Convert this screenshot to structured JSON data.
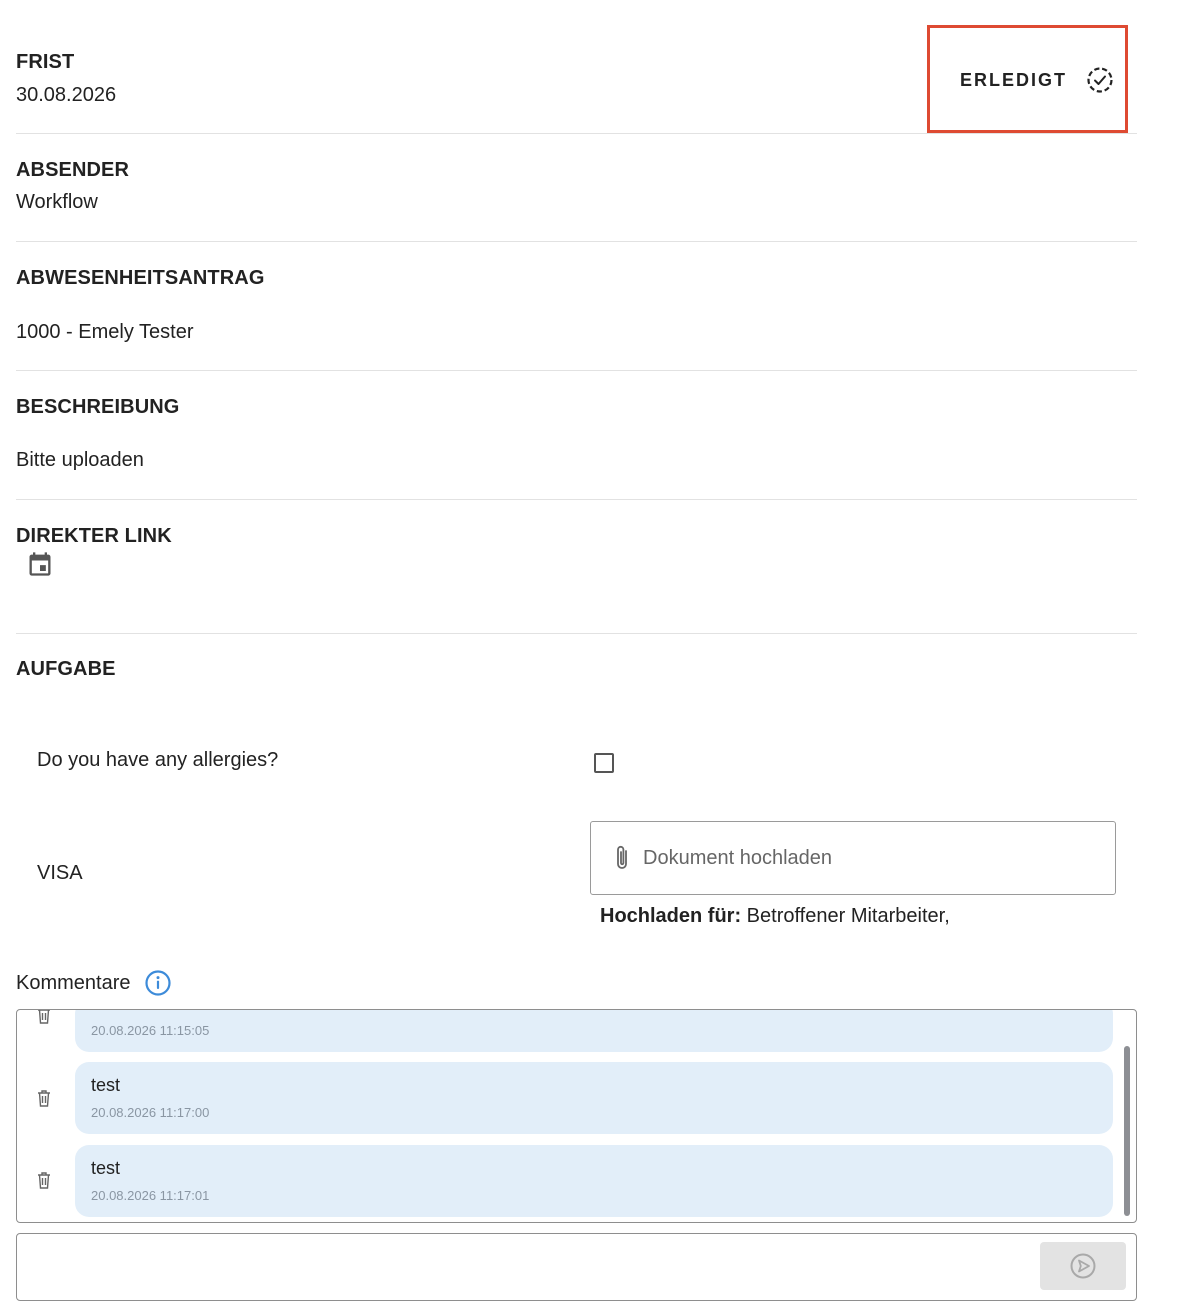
{
  "deadline": {
    "label": "FRIST",
    "value": "30.08.2026"
  },
  "done_button": {
    "label": "ERLEDIGT",
    "icon": "dashed-check-circle-icon",
    "highlight_color": "#de4a32"
  },
  "sender": {
    "label": "ABSENDER",
    "value": "Workflow"
  },
  "absence_request": {
    "label": "ABWESENHEITSANTRAG",
    "value": "1000 - Emely Tester"
  },
  "description": {
    "label": "BESCHREIBUNG",
    "value": "Bitte uploaden"
  },
  "direct_link": {
    "label": "DIREKTER LINK",
    "icon": "calendar-icon"
  },
  "task": {
    "label": "AUFGABE",
    "question": "Do you have any allergies?",
    "checkbox_checked": false,
    "visa_label": "VISA",
    "upload_placeholder": "Dokument hochladen",
    "upload_for_label": "Hochladen für:",
    "upload_for_value": " Betroffener Mitarbeiter,"
  },
  "comments": {
    "title": "Kommentare",
    "info_icon": "info-icon",
    "accent": "#3d8bd9",
    "items": [
      {
        "text": "",
        "timestamp": "20.08.2026 11:15:05"
      },
      {
        "text": "test",
        "timestamp": "20.08.2026 11:17:00"
      },
      {
        "text": "test",
        "timestamp": "20.08.2026 11:17:01"
      }
    ],
    "input_placeholder": "",
    "send_icon": "send-icon"
  }
}
